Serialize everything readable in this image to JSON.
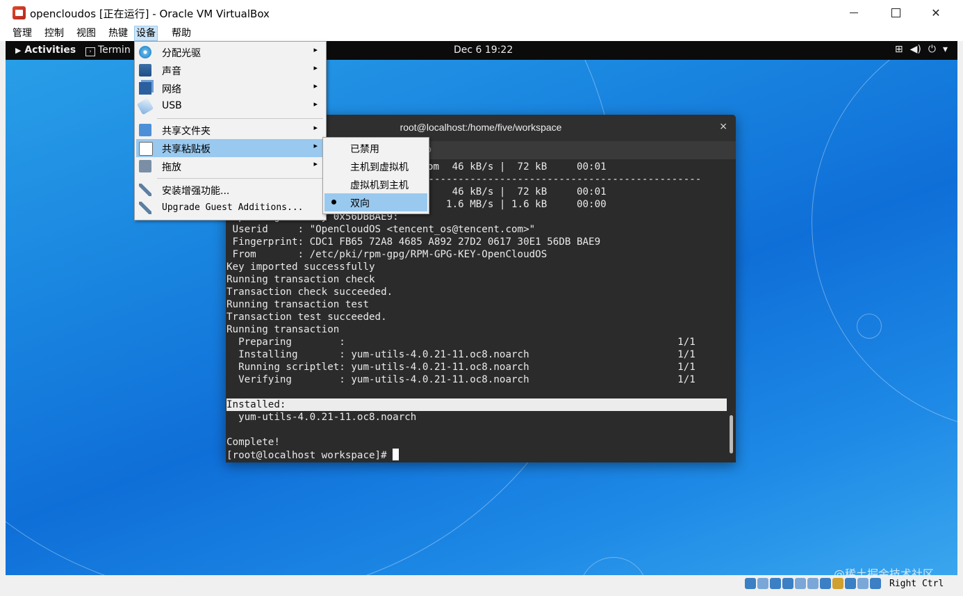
{
  "window": {
    "title": "opencloudos [正在运行] - Oracle VM VirtualBox",
    "minimize": "–",
    "close": "✕"
  },
  "menubar": [
    "管理",
    "控制",
    "视图",
    "热键",
    "设备",
    "帮助"
  ],
  "guest": {
    "activities": "Activities",
    "terminal_app": "Termin",
    "clock": "Dec 6  19:22",
    "tray": [
      "network-icon",
      "volume-icon",
      "power-icon",
      "chevron-down-icon"
    ]
  },
  "terminal": {
    "title": "root@localhost:/home/five/workspace",
    "close": "×",
    "lines": [
      "                                      46 kB/s |  72 kB     00:01",
      "--------------------------------------------------------------------------------",
      "                                      46 kB/s |  72 kB     00:01",
      "                                     1.6 MB/s | 1.6 kB     00:00",
      "Importing GPG key 0x56DBBAE9:",
      " Userid     : \"OpenCloudOS <tencent_os@tencent.com>\"",
      " Fingerprint: CDC1 FB65 72A8 4685 A892 27D2 0617 30E1 56DB BAE9",
      " From       : /etc/pki/rpm-gpg/RPM-GPG-KEY-OpenCloudOS",
      "Key imported successfully",
      "Running transaction check",
      "Transaction check succeeded.",
      "Running transaction test",
      "Transaction test succeeded.",
      "Running transaction",
      "  Preparing        :                                                        1/1",
      "  Installing       : yum-utils-4.0.21-11.oc8.noarch                         1/1",
      "  Running scriptlet: yum-utils-4.0.21-11.oc8.noarch                         1/1",
      "  Verifying        : yum-utils-4.0.21-11.oc8.noarch                         1/1",
      "",
      "Installed:",
      "  yum-utils-4.0.21-11.oc8.noarch",
      "",
      "Complete!",
      "[root@localhost workspace]#"
    ],
    "tab_partial": "o",
    "row1_partial": "om"
  },
  "device_menu": {
    "items": [
      {
        "label": "分配光驱",
        "icon": "optical-disc-icon"
      },
      {
        "label": "声音",
        "icon": "audio-icon"
      },
      {
        "label": "网络",
        "icon": "network-icon"
      },
      {
        "label": "USB",
        "icon": "usb-icon"
      },
      {
        "label": "共享文件夹",
        "icon": "shared-folder-icon"
      },
      {
        "label": "共享粘贴板",
        "icon": "clipboard-icon"
      },
      {
        "label": "拖放",
        "icon": "drag-drop-icon"
      },
      {
        "label": "安装增强功能...",
        "icon": "wrench-icon"
      },
      {
        "label": "Upgrade Guest Additions...",
        "icon": "wrench-icon"
      }
    ],
    "arrow": "▸"
  },
  "clipboard_menu": {
    "items": [
      "已禁用",
      "主机到虚拟机",
      "虚拟机到主机",
      "双向"
    ],
    "selected": "双向"
  },
  "status_bar": {
    "host_key": "Right Ctrl",
    "watermark": "@稀土掘金技术社区"
  }
}
